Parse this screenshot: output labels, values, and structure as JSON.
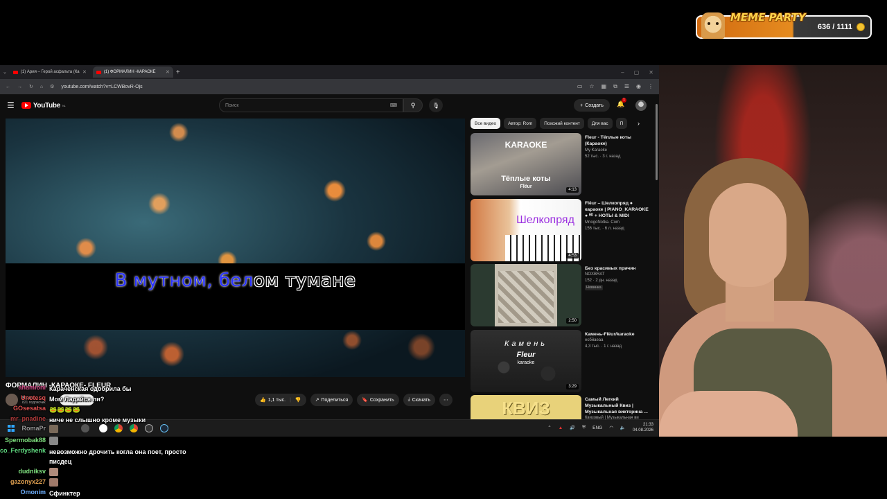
{
  "widget": {
    "title": "MEME PARTY",
    "count": "636 / 1111"
  },
  "browser": {
    "tabs": [
      {
        "label": "(1) Ария – Герой асфальта (Ка"
      },
      {
        "label": "(1) ФОРМАЛИН -КАРАОКЕ"
      }
    ],
    "url": "youtube.com/watch?v=LCWBovR-Ojs"
  },
  "youtube": {
    "logo": "YouTube",
    "logo_region": "NL",
    "search_placeholder": "Поиск",
    "create_label": "Создать",
    "notification_count": "1"
  },
  "video": {
    "lyric_sung": "В мутном, бел",
    "lyric_rest": "ом тумане",
    "title": "ФОРМАЛИН -КАРАОКЕ- FLEUR",
    "channel": "Rom",
    "subscribers": "821 подписчик",
    "subscribe": "Подписаться",
    "likes": "1,1 тыс.",
    "share": "Поделиться",
    "save": "Сохранить",
    "download": "Скачать"
  },
  "chips": [
    "Все видео",
    "Автор: Rom",
    "Похожий контент",
    "Для вас",
    "П"
  ],
  "recommendations": [
    {
      "title": "Fleur - Тёплые коты (Караоке)",
      "channel": "My Karaoke",
      "meta": "52 тыс. · 3 г. назад",
      "duration": "4:13",
      "thumb_top": "KARAOKE",
      "thumb_main": "Тёплые коты",
      "thumb_sub": "Flëur"
    },
    {
      "title": "Flëur – Шелкопряд ● караоке | PIANO_KARAOKE ● ᴴᴰ + НОТЫ & MIDI",
      "channel": "MnogoNotka. Com",
      "meta": "156 тыс. · 6 л. назад",
      "duration": "4:53",
      "thumb_main": "Шелкопряд"
    },
    {
      "title": "Без красивых причин",
      "channel": "NOXBRAT",
      "meta": "152 · 2 дн. назад",
      "badge": "Новинка",
      "duration": "2:50"
    },
    {
      "title": "Камень-Flëur/karaoke",
      "channel": "есбйаеаа",
      "meta": "4,3 тыс. · 1 г. назад",
      "duration": "3:29",
      "thumb_main": "Камень",
      "thumb_sub": "Fleur",
      "thumb_sub2": "karaoke"
    },
    {
      "title": "Самый Легкий Музыкальный Квиз | Музыкальная викторина ...",
      "channel": "Квизовый | Музыкальная ви",
      "thumb_main": "КВИЗ"
    }
  ],
  "taskbar": {
    "lang": "ENG",
    "time": "21:33",
    "date": "04.08.2026"
  },
  "chat": [
    {
      "user": "ahamioni",
      "text": "Караченская одобрила бы",
      "color": "#d44f8a"
    },
    {
      "user": "Unotesq",
      "text": "Мом Ладайся ли?",
      "color": "#e05050"
    },
    {
      "user": "GOsesatsa",
      "text": "🐸🐸🐸🐸",
      "color": "#e05050"
    },
    {
      "user": "mr_pnadine",
      "text": "ниче не слышно кроме музыки",
      "color": "#b03a3a"
    },
    {
      "user": "RomaPr",
      "text": "",
      "color": "#9a9a9a"
    },
    {
      "user": "Spermobak88",
      "text": "",
      "color": "#7fe07f"
    },
    {
      "user": "co_Ferdyshenko",
      "text": "невозможно дрочить когла она поет, просто",
      "color": "#5fd97f"
    },
    {
      "user": "",
      "text": "писдец",
      "color": "#fff"
    },
    {
      "user": "dudniksv",
      "text": "",
      "color": "#7fe07f"
    },
    {
      "user": "gazonyx227",
      "text": "",
      "color": "#e0a050"
    },
    {
      "user": "Omonim",
      "text": "Сфинктер",
      "color": "#6fb0ff"
    }
  ]
}
